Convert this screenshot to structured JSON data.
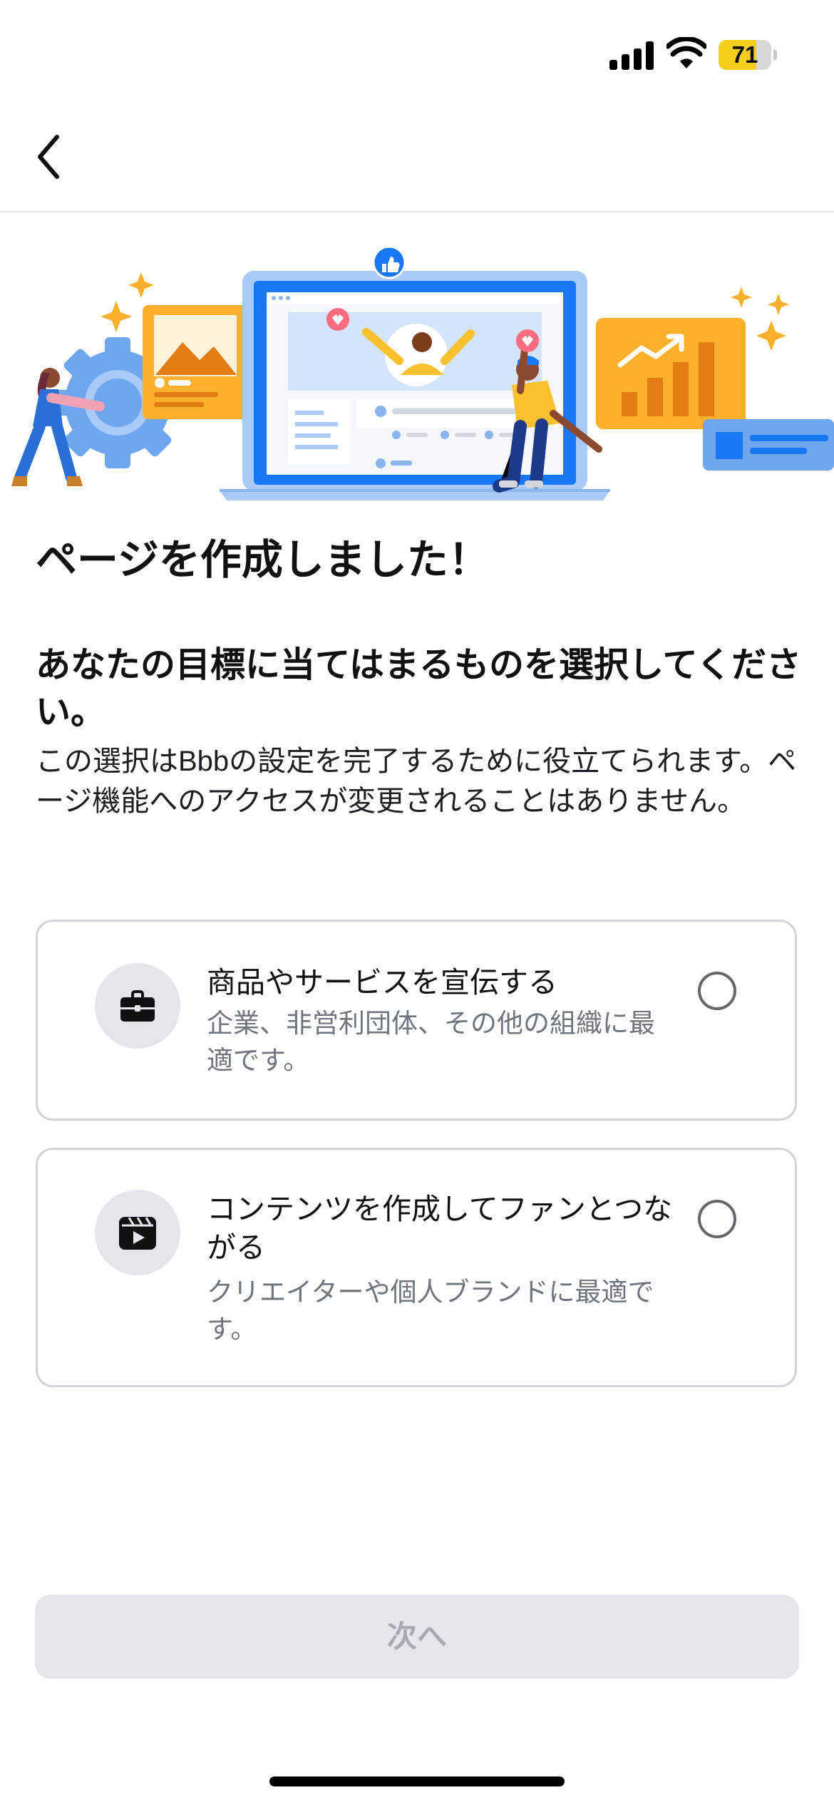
{
  "status_bar": {
    "battery_level": "71"
  },
  "nav": {
    "back_icon": "chevron-left-icon"
  },
  "content": {
    "title": "ページを作成しました！",
    "subtitle": "あなたの目標に当てはまるものを選択してください。",
    "description": "この選択はBbbの設定を完了するために役立てられます。ページ機能へのアクセスが変更されることはありません。"
  },
  "options": [
    {
      "icon": "briefcase-icon",
      "title": "商品やサービスを宣伝する",
      "subtitle": "企業、非営利団体、その他の組織に最適です。",
      "selected": false
    },
    {
      "icon": "video-clapperboard-icon",
      "title": "コンテンツを作成してファンとつながる",
      "subtitle": "クリエイターや個人ブランドに最適です。",
      "selected": false
    }
  ],
  "footer": {
    "next_label": "次へ",
    "next_enabled": false
  },
  "colors": {
    "accent_blue": "#1877f2",
    "illustration_orange": "#fbb02d",
    "button_disabled_bg": "#e4e6eb",
    "button_disabled_text": "#a7abb1",
    "battery_yellow": "#f7ce1b"
  }
}
